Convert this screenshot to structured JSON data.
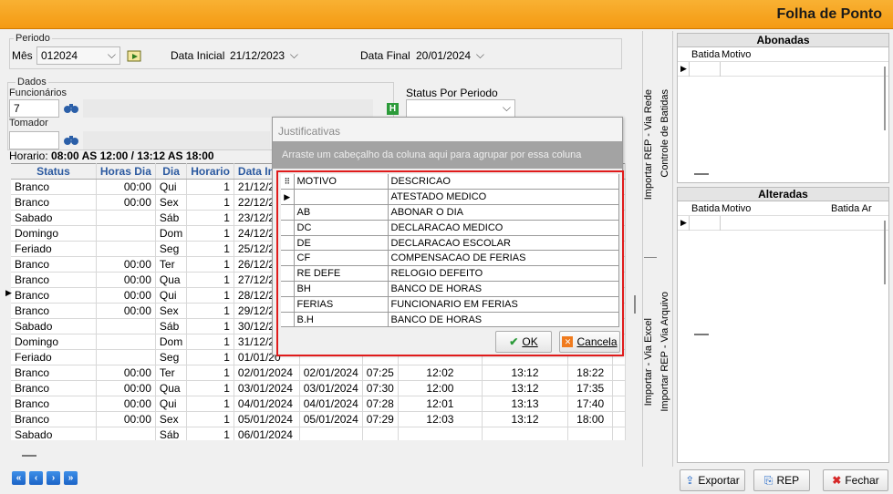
{
  "window": {
    "title": "Folha de Ponto"
  },
  "periodo": {
    "group_label": "Periodo",
    "mes_label": "Mês",
    "mes_value": "012024",
    "data_inicial_label": "Data Inicial",
    "data_inicial_value": "21/12/2023",
    "data_final_label": "Data Final",
    "data_final_value": "20/01/2024"
  },
  "dados": {
    "group_label": "Dados",
    "funcionarios_label": "Funcionários",
    "funcionario_value": "7",
    "status_label": "Status Por Periodo",
    "status_value": "",
    "tomador_label": "Tomador",
    "horario_label": "Horario:",
    "horario_value": "08:00 AS 12:00 / 13:12 AS 18:00"
  },
  "grid": {
    "columns": [
      "Status",
      "Horas Dia",
      "Dia",
      "Horario",
      "Data Ini"
    ],
    "rows": [
      {
        "status": "Branco",
        "horas": "00:00",
        "dia": "Qui",
        "horario": "1",
        "data": "21/12/20",
        "d2": "",
        "e1": "",
        "s1": "",
        "e2": "",
        "s2": ""
      },
      {
        "status": "Branco",
        "horas": "00:00",
        "dia": "Sex",
        "horario": "1",
        "data": "22/12/20",
        "d2": "",
        "e1": "",
        "s1": "",
        "e2": "",
        "s2": ""
      },
      {
        "status": "Sabado",
        "horas": "",
        "dia": "Sáb",
        "horario": "1",
        "data": "23/12/20",
        "d2": "",
        "e1": "",
        "s1": "",
        "e2": "",
        "s2": ""
      },
      {
        "status": "Domingo",
        "horas": "",
        "dia": "Dom",
        "horario": "1",
        "data": "24/12/20",
        "d2": "",
        "e1": "",
        "s1": "",
        "e2": "",
        "s2": ""
      },
      {
        "status": "Feriado",
        "horas": "",
        "dia": "Seg",
        "horario": "1",
        "data": "25/12/20",
        "d2": "",
        "e1": "",
        "s1": "",
        "e2": "",
        "s2": ""
      },
      {
        "status": "Branco",
        "horas": "00:00",
        "dia": "Ter",
        "horario": "1",
        "data": "26/12/20",
        "d2": "",
        "e1": "",
        "s1": "",
        "e2": "",
        "s2": ""
      },
      {
        "status": "Branco",
        "horas": "00:00",
        "dia": "Qua",
        "horario": "1",
        "data": "27/12/20",
        "d2": "",
        "e1": "",
        "s1": "",
        "e2": "",
        "s2": ""
      },
      {
        "status": "Branco",
        "horas": "00:00",
        "dia": "Qui",
        "horario": "1",
        "data": "28/12/20",
        "d2": "",
        "e1": "",
        "s1": "",
        "e2": "",
        "s2": ""
      },
      {
        "status": "Branco",
        "horas": "00:00",
        "dia": "Sex",
        "horario": "1",
        "data": "29/12/20",
        "d2": "",
        "e1": "",
        "s1": "",
        "e2": "",
        "s2": ""
      },
      {
        "status": "Sabado",
        "horas": "",
        "dia": "Sáb",
        "horario": "1",
        "data": "30/12/20",
        "d2": "",
        "e1": "",
        "s1": "",
        "e2": "",
        "s2": ""
      },
      {
        "status": "Domingo",
        "horas": "",
        "dia": "Dom",
        "horario": "1",
        "data": "31/12/20",
        "d2": "",
        "e1": "",
        "s1": "",
        "e2": "",
        "s2": ""
      },
      {
        "status": "Feriado",
        "horas": "",
        "dia": "Seg",
        "horario": "1",
        "data": "01/01/20",
        "d2": "",
        "e1": "",
        "s1": "",
        "e2": "",
        "s2": ""
      },
      {
        "status": "Branco",
        "horas": "00:00",
        "dia": "Ter",
        "horario": "1",
        "data": "02/01/2024",
        "d2": "02/01/2024",
        "e1": "07:25",
        "s1": "12:02",
        "e2": "13:12",
        "s2": "18:22"
      },
      {
        "status": "Branco",
        "horas": "00:00",
        "dia": "Qua",
        "horario": "1",
        "data": "03/01/2024",
        "d2": "03/01/2024",
        "e1": "07:30",
        "s1": "12:00",
        "e2": "13:12",
        "s2": "17:35"
      },
      {
        "status": "Branco",
        "horas": "00:00",
        "dia": "Qui",
        "horario": "1",
        "data": "04/01/2024",
        "d2": "04/01/2024",
        "e1": "07:28",
        "s1": "12:01",
        "e2": "13:13",
        "s2": "17:40"
      },
      {
        "status": "Branco",
        "horas": "00:00",
        "dia": "Sex",
        "horario": "1",
        "data": "05/01/2024",
        "d2": "05/01/2024",
        "e1": "07:29",
        "s1": "12:03",
        "e2": "13:12",
        "s2": "18:00"
      },
      {
        "status": "Sabado",
        "horas": "",
        "dia": "Sáb",
        "horario": "1",
        "data": "06/01/2024",
        "d2": "",
        "e1": "",
        "s1": "",
        "e2": "",
        "s2": ""
      }
    ]
  },
  "side_tabs": {
    "importar_rede": "Importar REP - Via Rede",
    "controle_batidas": "Controle de Batidas",
    "importar_excel": "Importar - Via Excel",
    "importar_arquivo": "Importar REP - Via Arquivo"
  },
  "abonadas": {
    "title": "Abonadas",
    "columns": [
      "Batida",
      "Motivo"
    ]
  },
  "alteradas": {
    "title": "Alteradas",
    "columns": [
      "Batida",
      "Motivo",
      "Batida Ar"
    ]
  },
  "dialog": {
    "title": "Justificativas",
    "group_hint": "Arraste um cabeçalho da coluna aqui para agrupar por essa coluna",
    "columns": [
      "MOTIVO",
      "DESCRICAO"
    ],
    "rows": [
      {
        "motivo": "",
        "descricao": "ATESTADO MEDICO"
      },
      {
        "motivo": "AB",
        "descricao": "ABONAR O DIA"
      },
      {
        "motivo": "DC",
        "descricao": "DECLARACAO MEDICO"
      },
      {
        "motivo": "DE",
        "descricao": "DECLARACAO ESCOLAR"
      },
      {
        "motivo": "CF",
        "descricao": "COMPENSACAO DE FERIAS"
      },
      {
        "motivo": "RE DEFE",
        "descricao": "RELOGIO DEFEITO"
      },
      {
        "motivo": "BH",
        "descricao": "BANCO DE HORAS"
      },
      {
        "motivo": "FERIAS",
        "descricao": "FUNCIONARIO EM FERIAS"
      },
      {
        "motivo": "B.H",
        "descricao": "BANCO DE HORAS"
      }
    ],
    "ok_label": "OK",
    "cancel_label": "Cancela"
  },
  "footer": {
    "exportar_label": "Exportar",
    "rep_label": "REP",
    "fechar_label": "Fechar"
  },
  "colors": {
    "accent_orange": "#f5a623",
    "header_blue": "#2c5aa0",
    "highlight_red": "#e01b1b"
  }
}
